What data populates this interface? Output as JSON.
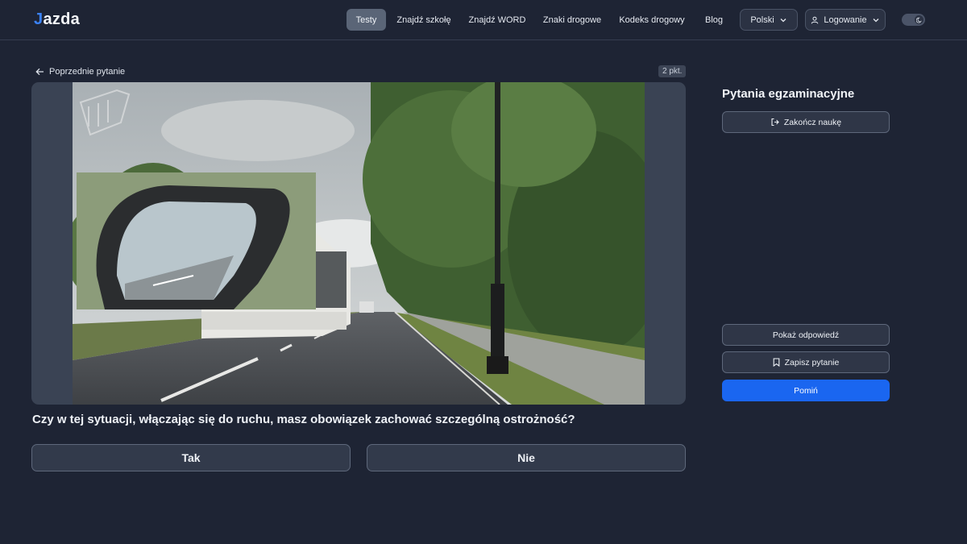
{
  "brand": {
    "logo_text": "azda",
    "logo_mark": "J"
  },
  "nav": {
    "items": [
      {
        "label": "Testy",
        "active": true
      },
      {
        "label": "Znajdź szkołę"
      },
      {
        "label": "Znajdź WORD"
      },
      {
        "label": "Znaki drogowe"
      },
      {
        "label": "Kodeks drogowy"
      },
      {
        "label": "Blog"
      }
    ],
    "language": "Polski",
    "login": "Logowanie",
    "theme_toggle_icon": "moon-icon"
  },
  "question_card": {
    "prev_label": "Poprzednie pytanie",
    "points": "2 pkt.",
    "media_description_icons": [
      "watermark-logo",
      "side-mirror-inset"
    ],
    "question_text": "Czy w tej sytuacji, włączając się do ruchu, masz obowiązek zachować szczególną ostrożność?",
    "answers": [
      "Tak",
      "Nie"
    ]
  },
  "side_panel": {
    "title": "Pytania egzaminacyjne",
    "end_button": "Zakończ naukę",
    "show_answer": "Pokaż odpowiedź",
    "save_question": "Zapisz pytanie",
    "skip": "Pomiń"
  },
  "colors": {
    "background": "#1e2434",
    "accent": "#1a66f0",
    "brand": "#3b82f6"
  }
}
